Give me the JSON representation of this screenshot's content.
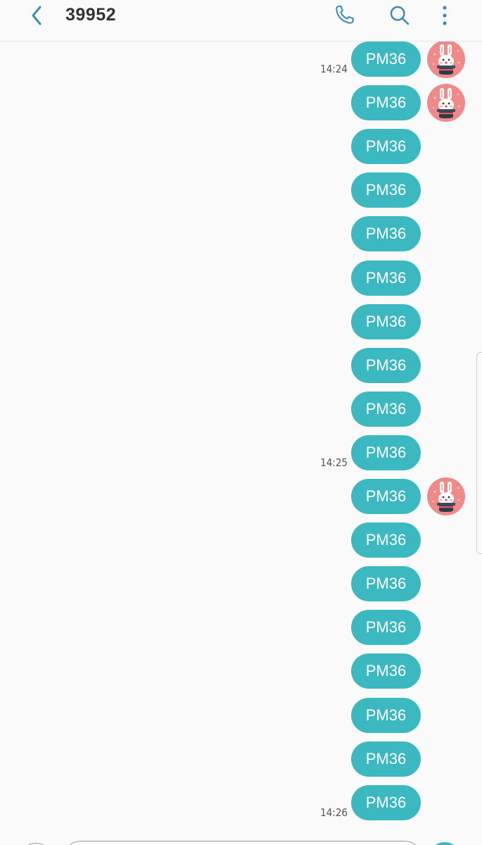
{
  "header": {
    "title": "39952",
    "back_icon": "chevron-left-icon",
    "call_icon": "phone-icon",
    "search_icon": "search-icon",
    "more_icon": "more-vertical-icon",
    "accent_color": "#3b8fb0"
  },
  "messages": [
    {
      "text": "PM36",
      "time": "14:24",
      "avatar": true
    },
    {
      "text": "PM36",
      "time": "",
      "avatar": true
    },
    {
      "text": "PM36",
      "time": "",
      "avatar": false
    },
    {
      "text": "PM36",
      "time": "",
      "avatar": false
    },
    {
      "text": "PM36",
      "time": "",
      "avatar": false
    },
    {
      "text": "PM36",
      "time": "",
      "avatar": false
    },
    {
      "text": "PM36",
      "time": "",
      "avatar": false
    },
    {
      "text": "PM36",
      "time": "",
      "avatar": false
    },
    {
      "text": "PM36",
      "time": "",
      "avatar": false
    },
    {
      "text": "PM36",
      "time": "14:25",
      "avatar": false
    },
    {
      "text": "PM36",
      "time": "",
      "avatar": true
    },
    {
      "text": "PM36",
      "time": "",
      "avatar": false
    },
    {
      "text": "PM36",
      "time": "",
      "avatar": false
    },
    {
      "text": "PM36",
      "time": "",
      "avatar": false
    },
    {
      "text": "PM36",
      "time": "",
      "avatar": false
    },
    {
      "text": "PM36",
      "time": "",
      "avatar": false
    },
    {
      "text": "PM36",
      "time": "",
      "avatar": false
    },
    {
      "text": "PM36",
      "time": "14:26",
      "avatar": false
    }
  ],
  "colors": {
    "bubble": "#3bb8c0",
    "bubble_text": "#ffffff",
    "background": "#fafafa",
    "avatar_bg": "#f08a8a"
  },
  "avatar_icon": "magician-rabbit-icon",
  "composer": {
    "attach_icon": "add-circle-icon",
    "send_icon": "send-icon"
  }
}
